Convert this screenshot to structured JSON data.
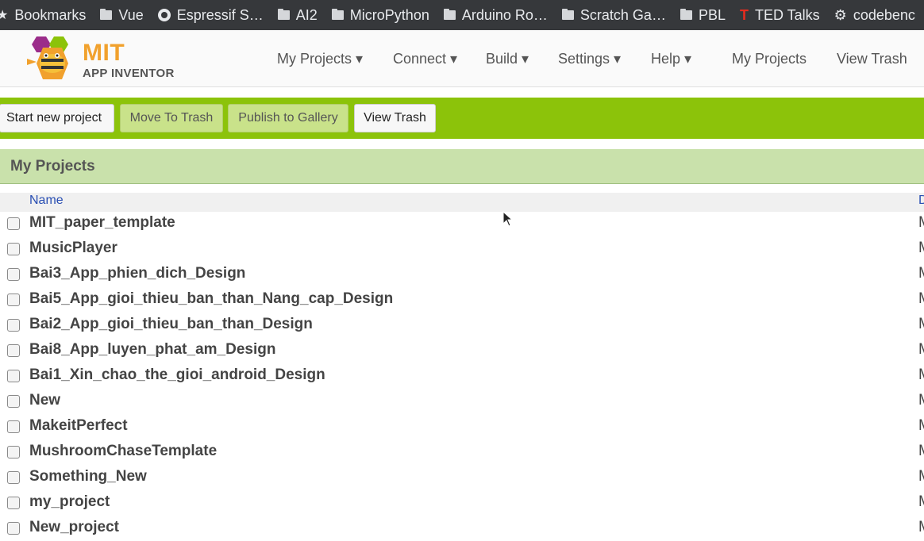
{
  "bookmarks": [
    {
      "label": "Bookmarks",
      "icon": "star-icon"
    },
    {
      "label": "Vue",
      "icon": "folder-icon"
    },
    {
      "label": "Espressif S…",
      "icon": "github-icon"
    },
    {
      "label": "AI2",
      "icon": "folder-icon"
    },
    {
      "label": "MicroPython",
      "icon": "folder-icon"
    },
    {
      "label": "Arduino Ro…",
      "icon": "folder-icon"
    },
    {
      "label": "Scratch Ga…",
      "icon": "folder-icon"
    },
    {
      "label": "PBL",
      "icon": "folder-icon"
    },
    {
      "label": "TED Talks",
      "icon": "ted-icon"
    },
    {
      "label": "codebenc",
      "icon": "gear-icon"
    }
  ],
  "logo": {
    "line1": "MIT",
    "line2": "APP INVENTOR"
  },
  "nav": {
    "my_projects_menu": "My Projects ▾",
    "connect": "Connect ▾",
    "build": "Build ▾",
    "settings": "Settings ▾",
    "help": "Help ▾",
    "my_projects_link": "My Projects",
    "view_trash_link": "View Trash"
  },
  "toolbar": {
    "start_new": "Start new project",
    "move_to_trash": "Move To Trash",
    "publish": "Publish to Gallery",
    "view_trash": "View Trash"
  },
  "section": {
    "title": "My Projects"
  },
  "table": {
    "columns": {
      "name": "Name",
      "date": "D"
    },
    "rows": [
      {
        "name": "MIT_paper_template",
        "date": "M"
      },
      {
        "name": "MusicPlayer",
        "date": "M"
      },
      {
        "name": "Bai3_App_phien_dich_Design",
        "date": "M"
      },
      {
        "name": "Bai5_App_gioi_thieu_ban_than_Nang_cap_Design",
        "date": "M"
      },
      {
        "name": "Bai2_App_gioi_thieu_ban_than_Design",
        "date": "M"
      },
      {
        "name": "Bai8_App_luyen_phat_am_Design",
        "date": "M"
      },
      {
        "name": "Bai1_Xin_chao_the_gioi_android_Design",
        "date": "M"
      },
      {
        "name": "New",
        "date": "M"
      },
      {
        "name": "MakeitPerfect",
        "date": "M"
      },
      {
        "name": "MushroomChaseTemplate",
        "date": "M"
      },
      {
        "name": "Something_New",
        "date": "M"
      },
      {
        "name": "my_project",
        "date": "M"
      },
      {
        "name": "New_project",
        "date": "M"
      }
    ]
  },
  "colors": {
    "toolbar_green": "#8cc30a",
    "section_green": "#c9e1ab",
    "logo_orange": "#f1a12d",
    "link_blue": "#2a4fb3"
  }
}
